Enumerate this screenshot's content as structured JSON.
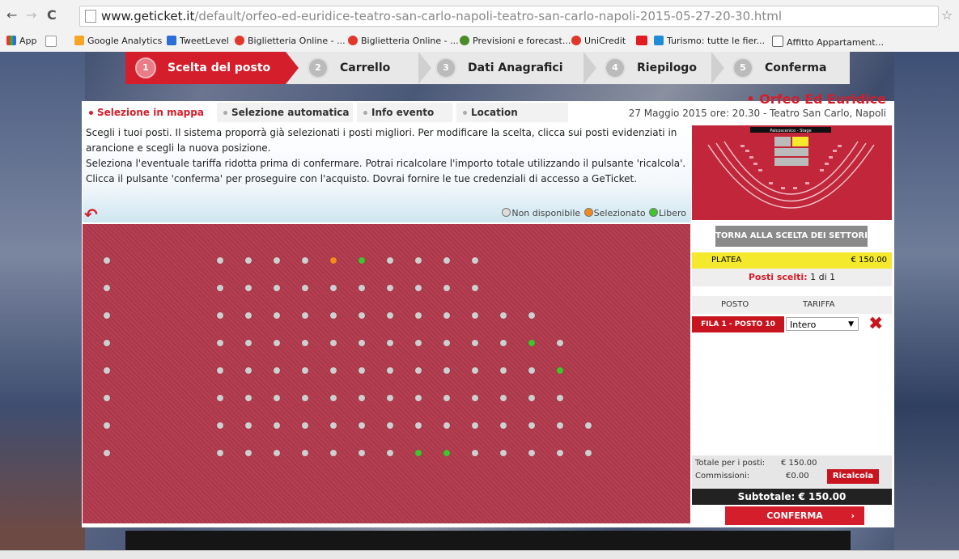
{
  "browser": {
    "url_host": "www.geticket.it",
    "url_path": "/default/orfeo-ed-euridice-teatro-san-carlo-napoli-teatro-san-carlo-napoli-2015-05-27-20-30.html",
    "bookmarks": [
      "App",
      "Google Analytics",
      "TweetLevel",
      "Biglietteria Online - ...",
      "Biglietteria Online - ...",
      "Previsioni e forecast...",
      "UniCredit",
      "Turismo: tutte le fier...",
      "Affitto Appartament..."
    ]
  },
  "steps": [
    {
      "num": "1",
      "label": "Scelta del posto"
    },
    {
      "num": "2",
      "label": "Carrello"
    },
    {
      "num": "3",
      "label": "Dati Anagrafici"
    },
    {
      "num": "4",
      "label": "Riepilogo"
    },
    {
      "num": "5",
      "label": "Conferma"
    }
  ],
  "tabs": [
    "Selezione in mappa",
    "Selezione automatica",
    "Info evento",
    "Location"
  ],
  "event": {
    "title": "• Orfeo Ed Euridice",
    "date": "27 Maggio 2015 ore: 20.30 - Teatro San Carlo, Napoli"
  },
  "instructions": [
    "Scegli i tuoi posti. Il sistema proporrà già selezionati i posti migliori. Per modificare la scelta, clicca sui posti evidenziati in arancione e scegli la nuova posizione.",
    "Seleziona l'eventuale tariffa ridotta prima di confermare. Potrai ricalcolare l'importo totale utilizzando il pulsante 'ricalcola'.",
    "Clicca il pulsante 'conferma' per proseguire con l'acquisto. Dovrai fornire le tue credenziali di accesso a GeTicket."
  ],
  "legend": {
    "unavailable": "Non disponibile",
    "selected": "Selezionato",
    "free": "Libero"
  },
  "thumbnail_label": "Palcoscenico - Stage",
  "seatmap": {
    "rows": [
      {
        "seats": [
          "n",
          "gap",
          "gap",
          "gap",
          "n",
          "n",
          "n",
          "n",
          "s",
          "f",
          "n",
          "n",
          "n",
          "n"
        ]
      },
      {
        "seats": [
          "n",
          "gap",
          "gap",
          "gap",
          "n",
          "n",
          "n",
          "n",
          "n",
          "n",
          "n",
          "n",
          "n",
          "n"
        ]
      },
      {
        "seats": [
          "n",
          "gap",
          "gap",
          "gap",
          "n",
          "n",
          "n",
          "n",
          "n",
          "n",
          "n",
          "n",
          "n",
          "n",
          "n",
          "n"
        ]
      },
      {
        "seats": [
          "n",
          "gap",
          "gap",
          "gap",
          "n",
          "n",
          "n",
          "n",
          "n",
          "n",
          "n",
          "n",
          "n",
          "n",
          "n",
          "f",
          "n"
        ]
      },
      {
        "seats": [
          "n",
          "gap",
          "gap",
          "gap",
          "n",
          "n",
          "n",
          "n",
          "n",
          "n",
          "n",
          "n",
          "n",
          "n",
          "n",
          "n",
          "f"
        ]
      },
      {
        "seats": [
          "n",
          "gap",
          "gap",
          "gap",
          "n",
          "n",
          "n",
          "n",
          "n",
          "n",
          "n",
          "n",
          "n",
          "n",
          "n",
          "n",
          "n"
        ]
      },
      {
        "seats": [
          "n",
          "gap",
          "gap",
          "gap",
          "n",
          "n",
          "n",
          "n",
          "n",
          "n",
          "n",
          "n",
          "n",
          "n",
          "n",
          "n",
          "n",
          "n"
        ]
      },
      {
        "seats": [
          "n",
          "gap",
          "gap",
          "gap",
          "n",
          "n",
          "n",
          "n",
          "n",
          "n",
          "n",
          "f",
          "f",
          "n",
          "n",
          "n",
          "n",
          "n"
        ]
      }
    ]
  },
  "sidebar": {
    "torna": "TORNA ALLA SCELTA DEI SETTORI",
    "sector": "PLATEA",
    "price": "€ 150.00",
    "posti_label": "Posti scelti:",
    "posti_value": "1 di 1",
    "col_posto": "POSTO",
    "col_tariffa": "TARIFFA",
    "fila": "FILA 1 - POSTO 10",
    "tariffa": "Intero",
    "totale_label": "Totale per i posti:",
    "totale_value": "€ 150.00",
    "commissioni_label": "Commissioni:",
    "commissioni_value": "€0.00",
    "ricalcola": "Ricalcola",
    "subtotale": "Subtotale: € 150.00",
    "conferma": "CONFERMA"
  }
}
